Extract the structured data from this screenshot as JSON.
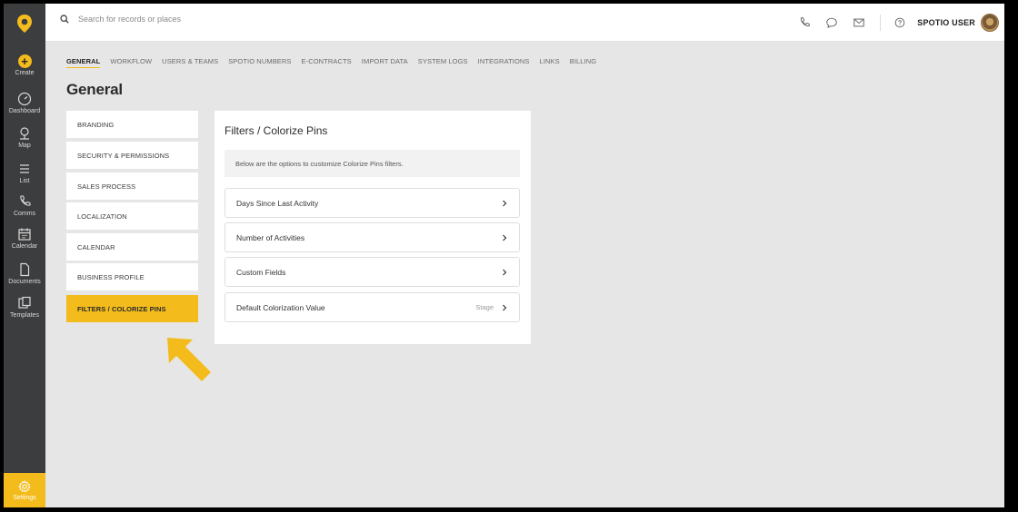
{
  "sidebar": {
    "items": [
      {
        "label": "Create",
        "icon": "plus-icon"
      },
      {
        "label": "Dashboard",
        "icon": "dashboard-icon"
      },
      {
        "label": "Map",
        "icon": "map-pin-icon"
      },
      {
        "label": "List",
        "icon": "list-icon"
      },
      {
        "label": "Comms",
        "icon": "phone-icon"
      },
      {
        "label": "Calendar",
        "icon": "calendar-icon"
      },
      {
        "label": "Documents",
        "icon": "document-icon"
      },
      {
        "label": "Templates",
        "icon": "templates-icon"
      }
    ],
    "settings_label": "Settings",
    "accent": "#f3bc1c"
  },
  "topbar": {
    "search_placeholder": "Search for records or places",
    "user_name": "SPOTIO USER"
  },
  "tabs": [
    {
      "label": "GENERAL",
      "active": true
    },
    {
      "label": "WORKFLOW"
    },
    {
      "label": "USERS & TEAMS"
    },
    {
      "label": "SPOTIO NUMBERS"
    },
    {
      "label": "E-CONTRACTS"
    },
    {
      "label": "IMPORT DATA"
    },
    {
      "label": "SYSTEM LOGS"
    },
    {
      "label": "INTEGRATIONS"
    },
    {
      "label": "LINKS"
    },
    {
      "label": "BILLING"
    }
  ],
  "page_title": "General",
  "menu": [
    {
      "label": "BRANDING"
    },
    {
      "label": "SECURITY & PERMISSIONS"
    },
    {
      "label": "SALES PROCESS"
    },
    {
      "label": "LOCALIZATION"
    },
    {
      "label": "CALENDAR"
    },
    {
      "label": "BUSINESS PROFILE"
    },
    {
      "label": "FILTERS / COLORIZE PINS",
      "active": true
    }
  ],
  "panel": {
    "title": "Filters / Colorize Pins",
    "description": "Below are the options to customize Colorize Pins filters.",
    "options": [
      {
        "label": "Days Since Last Activity",
        "value": ""
      },
      {
        "label": "Number of Activities",
        "value": ""
      },
      {
        "label": "Custom Fields",
        "value": ""
      },
      {
        "label": "Default Colorization Value",
        "value": "Stage"
      }
    ]
  }
}
